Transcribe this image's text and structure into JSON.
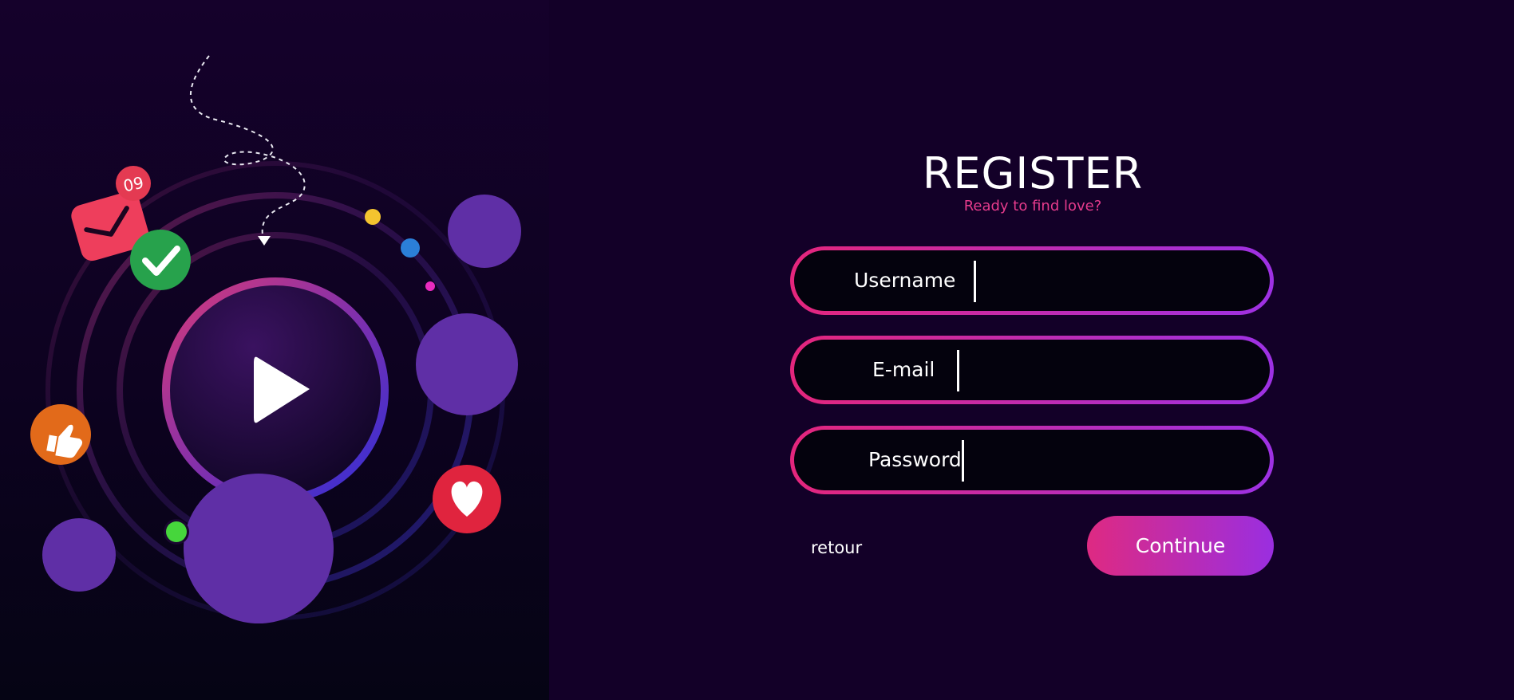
{
  "register": {
    "title": "REGISTER",
    "subtitle": "Ready to find love?"
  },
  "form": {
    "username_label": "Username",
    "username_value": "",
    "email_label": "E-mail",
    "email_value": "",
    "password_label": "Password",
    "password_value": ""
  },
  "actions": {
    "back_label": "retour",
    "continue_label": "Continue"
  },
  "illustration": {
    "notification_badge": "09",
    "icons": [
      "play-icon",
      "mail-icon",
      "check-icon",
      "thumbs-up-icon",
      "heart-icon"
    ]
  },
  "colors": {
    "background": "#130028",
    "accent_pink": "#e4267c",
    "accent_purple": "#9d31e4",
    "bubble_purple": "#5f2fa6"
  }
}
